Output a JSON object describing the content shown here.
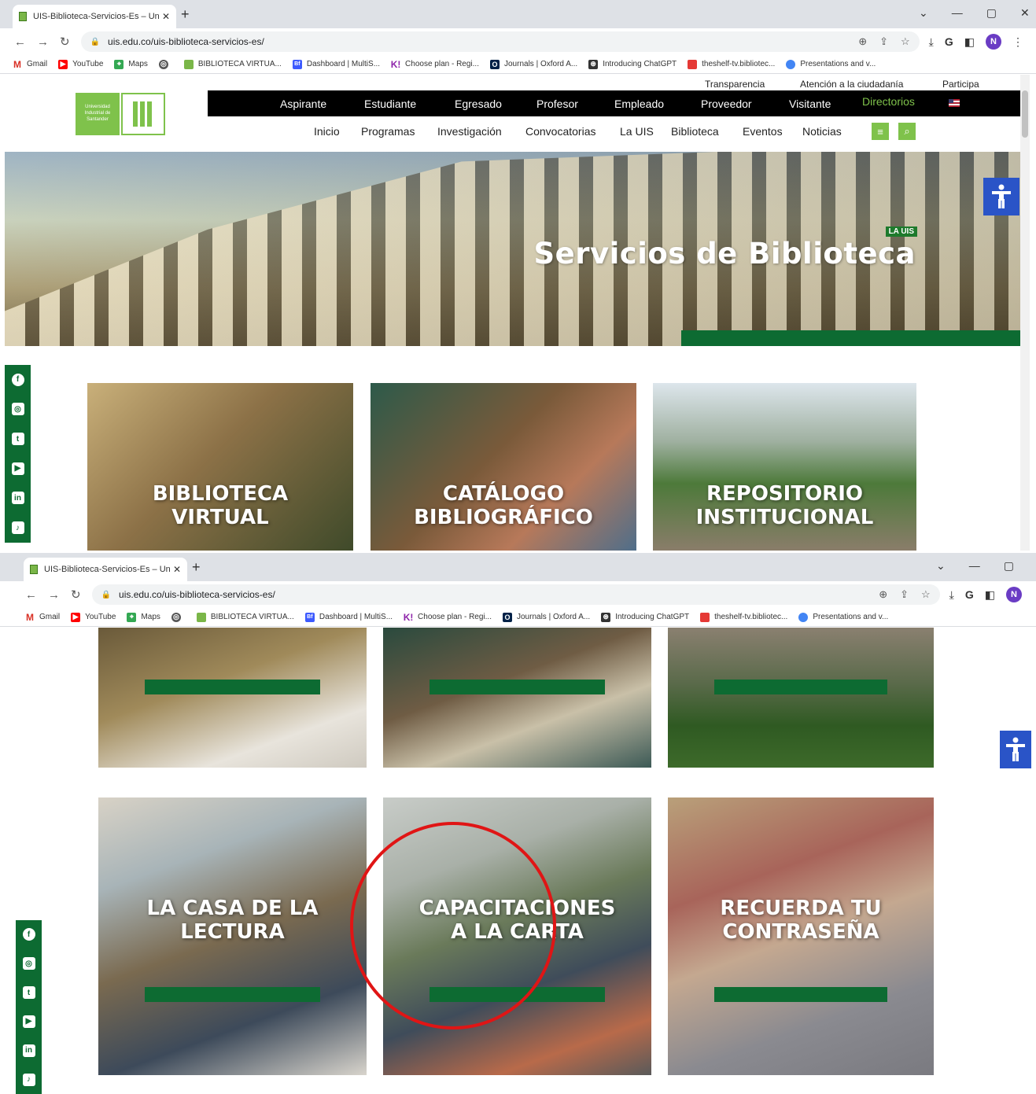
{
  "browser": {
    "tab_title": "UIS-Biblioteca-Servicios-Es – Uni",
    "url": "uis.edu.co/uis-biblioteca-servicios-es/",
    "profile_initial": "N",
    "bookmarks": [
      "Gmail",
      "YouTube",
      "Maps",
      "BIBLIOTECA VIRTUA...",
      "Dashboard | MultiS...",
      "Choose plan - Regi...",
      "Journals | Oxford A...",
      "Introducing ChatGPT",
      "theshelf-tv.bibliotec...",
      "Presentations and v..."
    ]
  },
  "header": {
    "top_links": [
      "Transparencia",
      "Atención a la ciudadanía",
      "Participa"
    ],
    "logo_text": "Universidad Industrial de Santander",
    "profile_nav": [
      "Aspirante",
      "Estudiante",
      "Egresado",
      "Profesor",
      "Empleado",
      "Proveedor",
      "Visitante",
      "Directorios"
    ],
    "main_nav": [
      "Inicio",
      "Programas",
      "Investigación",
      "Convocatorias",
      "La UIS",
      "Biblioteca",
      "Eventos",
      "Noticias"
    ]
  },
  "hero": {
    "badge": "LA UIS",
    "title": "Servicios de Biblioteca"
  },
  "cards_row1": [
    {
      "line1": "BIBLIOTECA",
      "line2": "VIRTUAL"
    },
    {
      "line1": "CATÁLOGO",
      "line2": "BIBLIOGRÁFICO"
    },
    {
      "line1": "REPOSITORIO",
      "line2": "INSTITUCIONAL"
    }
  ],
  "cards_row2": [
    {
      "line1": "LA CASA DE LA",
      "line2": "LECTURA"
    },
    {
      "line1": "CAPACITACIONES",
      "line2": "A LA CARTA"
    },
    {
      "line1": "RECUERDA TU",
      "line2": "CONTRASEÑA"
    }
  ],
  "social": [
    "facebook-icon",
    "instagram-icon",
    "twitter-icon",
    "youtube-icon",
    "linkedin-icon",
    "tiktok-icon"
  ],
  "colors": {
    "brand_green": "#0d6b32",
    "light_green": "#7fc24b",
    "accessibility_blue": "#2a54c7",
    "highlight_red": "#e01515"
  }
}
